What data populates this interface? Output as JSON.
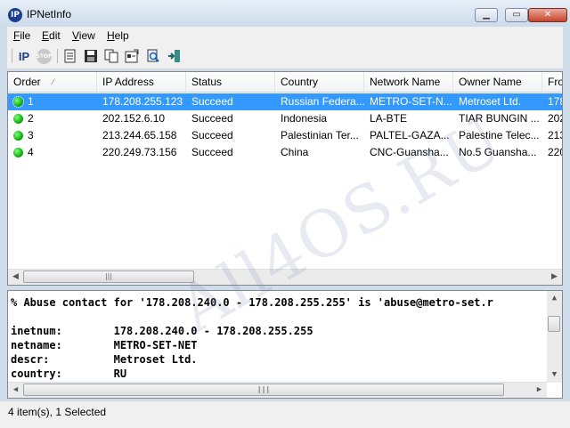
{
  "window": {
    "title": "IPNetInfo"
  },
  "menu": [
    {
      "accel": "F",
      "rest": "ile"
    },
    {
      "accel": "E",
      "rest": "dit"
    },
    {
      "accel": "V",
      "rest": "iew"
    },
    {
      "accel": "H",
      "rest": "elp"
    }
  ],
  "toolbar": {
    "ip_label": "IP",
    "stop_label": "STOP"
  },
  "table": {
    "columns": [
      "Order",
      "IP Address",
      "Status",
      "Country",
      "Network Name",
      "Owner Name",
      "Fro"
    ],
    "rows": [
      {
        "order": "1",
        "ip": "178.208.255.123",
        "status": "Succeed",
        "country": "Russian Federa...",
        "network": "METRO-SET-N...",
        "owner": "Metroset Ltd.",
        "from": "178"
      },
      {
        "order": "2",
        "ip": "202.152.6.10",
        "status": "Succeed",
        "country": "Indonesia",
        "network": "LA-BTE",
        "owner": "TIAR BUNGIN ...",
        "from": "202"
      },
      {
        "order": "3",
        "ip": "213.244.65.158",
        "status": "Succeed",
        "country": "Palestinian Ter...",
        "network": "PALTEL-GAZA...",
        "owner": "Palestine Telec...",
        "from": "213"
      },
      {
        "order": "4",
        "ip": "220.249.73.156",
        "status": "Succeed",
        "country": "China",
        "network": "CNC-Guansha...",
        "owner": "No.5 Guansha...",
        "from": "220"
      }
    ],
    "selected_index": 0
  },
  "details": {
    "lines": [
      "% Abuse contact for '178.208.240.0 - 178.208.255.255' is 'abuse@metro-set.r",
      "",
      "inetnum:        178.208.240.0 - 178.208.255.255",
      "netname:        METRO-SET-NET",
      "descr:          Metroset Ltd.",
      "country:        RU"
    ]
  },
  "status": {
    "text": "4 item(s), 1 Selected"
  },
  "watermark": {
    "text": "All4OS.RU"
  },
  "colors": {
    "selection": "#3399ff",
    "status_dot": "#10b010"
  }
}
